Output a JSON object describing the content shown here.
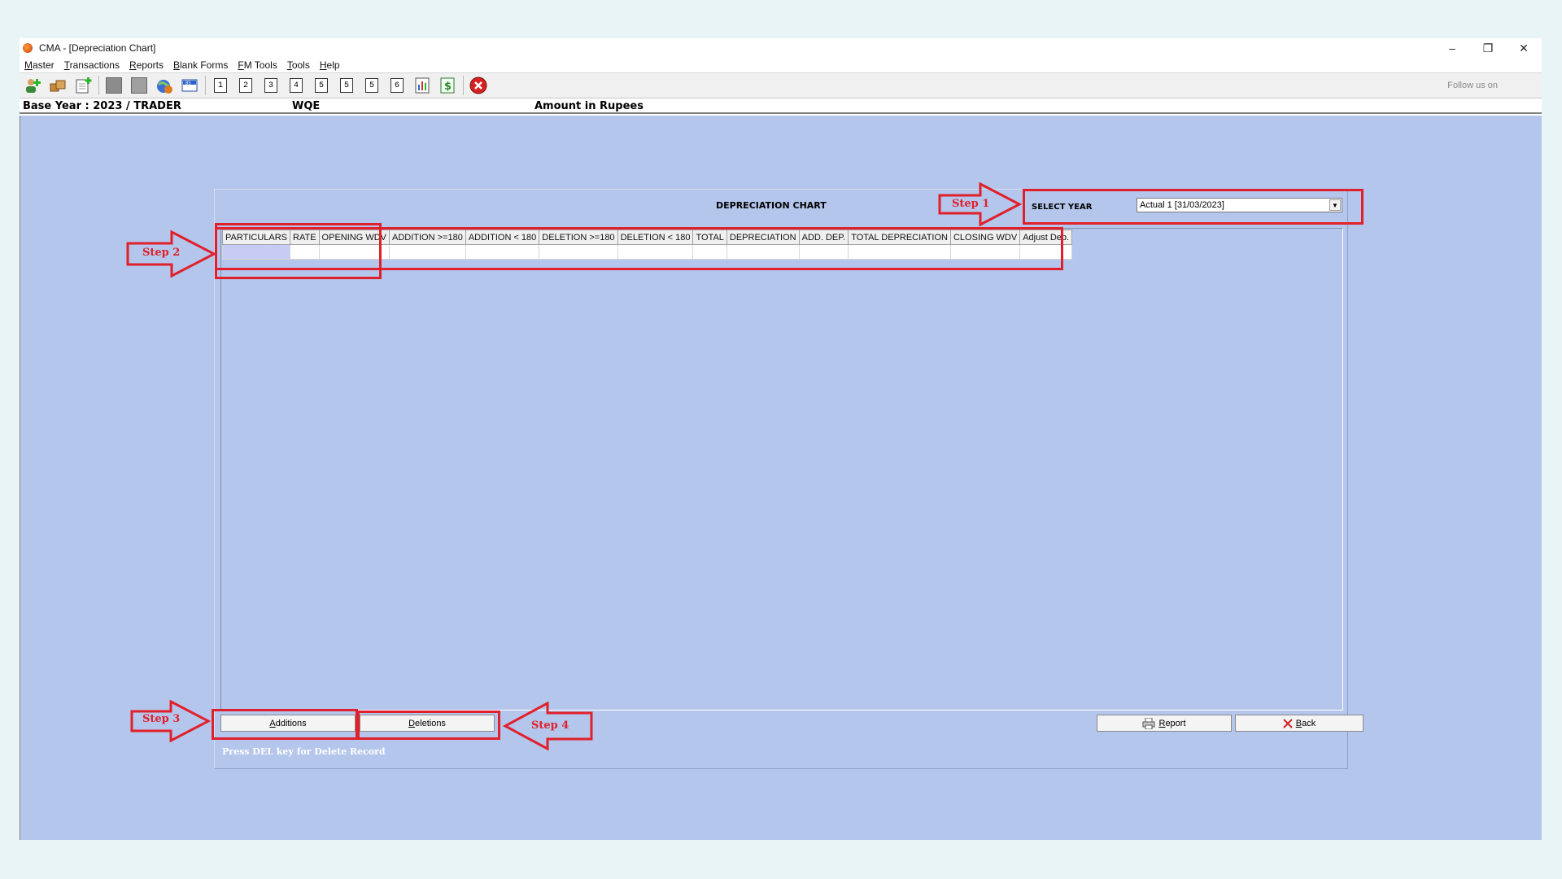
{
  "window": {
    "title": "CMA - [Depreciation Chart]",
    "controls": [
      "–",
      "❐",
      "✕"
    ]
  },
  "menu": {
    "items": [
      "Master",
      "Transactions",
      "Reports",
      "Blank Forms",
      "FM Tools",
      "Tools",
      "Help"
    ]
  },
  "toolbar": {
    "icons": [
      "add-party-icon",
      "boxes-icon",
      "new-doc-icon",
      "gray-square-icon",
      "gray-square-icon",
      "globe-icon",
      "bs-icon"
    ],
    "numbers": [
      "1",
      "2",
      "3",
      "4",
      "5",
      "5",
      "5",
      "6"
    ],
    "extra_icons": [
      "chart-icon",
      "dollar-icon",
      "close-icon"
    ],
    "follow_text": "Follow us on"
  },
  "infobar": {
    "base_year": "Base Year : 2023 / TRADER",
    "company": "WQE",
    "amount_unit": "Amount in Rupees"
  },
  "form": {
    "title": "DEPRECIATION CHART",
    "select_year_label": "SELECT YEAR",
    "select_year_value": "Actual 1 [31/03/2023]",
    "columns": [
      "PARTICULARS",
      "RATE",
      "OPENING WDV",
      "ADDITION >=180",
      "ADDITION < 180",
      "DELETION >=180",
      "DELETION < 180",
      "TOTAL",
      "DEPRECIATION",
      "ADD. DEP.",
      "TOTAL DEPRECIATION",
      "CLOSING WDV",
      "Adjust Dep."
    ],
    "additions_label": "Additions",
    "deletions_label": "Deletions",
    "report_label": "Report",
    "back_label": "Back",
    "hint": "Press DEL key for Delete Record"
  },
  "annotations": {
    "step1": "Step 1",
    "step2": "Step 2",
    "step3": "Step 3",
    "step4": "Step 4",
    "color": "#e0202a"
  },
  "colors": {
    "content_bg": "#b4c6ec",
    "selected_cell": "#c8ccf4",
    "annotation": "#e0202a"
  }
}
